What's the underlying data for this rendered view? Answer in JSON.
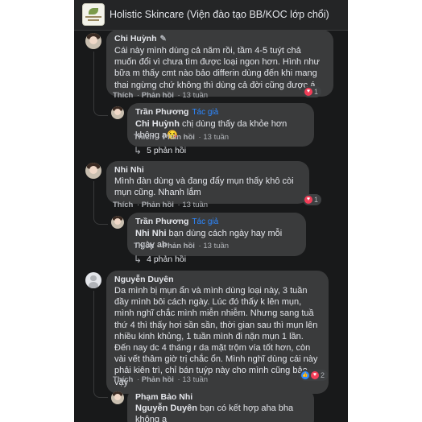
{
  "header": {
    "title": "Holistic Skincare (Viện đào tạo BB/KOC lớp chổi)"
  },
  "labels": {
    "like": "Thích",
    "reply": "Phản hồi",
    "author": "Tác giả"
  },
  "comments": [
    {
      "name": "Chi Huỳnh",
      "text": "Cái này mình dùng cả năm rồi, tầm 4-5 tuýt chả muốn đổi vì chưa tìm được loại ngon hơn. Hình như bữa m thấy cmt nào bảo differin dùng đến khi mang thai ngừng chứ không thì dùng cả đời cũng được á",
      "time": "13 tuần",
      "reaction_count": "1",
      "reply": {
        "name": "Trần Phương",
        "mention": "Chi Huỳnh",
        "text": " chị dùng thấy da khỏe hơn không ạ😘",
        "time": "13 tuần"
      },
      "more_replies": "5 phản hồi"
    },
    {
      "name": "Nhi Nhi",
      "text": "Mình đàn dùng và đang đẩy mụn thấy khô còi mụn cũng. Nhanh lắm",
      "time": "13 tuần",
      "reaction_count": "1",
      "reply": {
        "name": "Trần Phương",
        "mention": "Nhi Nhi",
        "text": " bạn dùng cách ngày hay mỗi ngày ah",
        "time": "13 tuần"
      },
      "more_replies": "4 phản hồi"
    },
    {
      "name": "Nguyễn Duyên",
      "text": "Da mình bị mụn ẩn và mình dùng loại này, 3 tuần đầy mình bôi cách ngày. Lúc đó thấy k lên mụn, mình nghĩ chắc mình miễn nhiễm. Nhưng sang tuầ thứ 4 thì thấy hơi sần sần, thời gian sau thì mụn lên nhiều kinh khủng, 1 tuần mình đi nặn mụn 1 lần. Đến nay dc 4 tháng r da mặt trộm vía tốt hơn, còn vài vết thâm giờ trị chắc ổn. Mình nghĩ dùng cái này phải kiên trì, chỉ bán tuýp này cho mình cũng bảo vậy",
      "time": "13 tuần",
      "reaction_count": "2",
      "reply": {
        "name": "Phạm Bảo Nhi",
        "mention": "Nguyễn Duyên",
        "text": " bạn có kết hợp aha bha không ạ",
        "time": ""
      }
    }
  ]
}
